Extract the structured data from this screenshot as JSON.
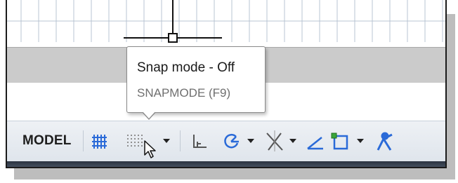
{
  "tooltip": {
    "title": "Snap mode - Off",
    "command": "SNAPMODE (F9)"
  },
  "status_bar": {
    "model_label": "MODEL",
    "icons": [
      "grid-icon",
      "snap-mode-icon",
      "snap-dropdown-icon",
      "ortho-icon",
      "polar-tracking-icon",
      "polar-dropdown-icon",
      "isodraft-icon",
      "isodraft-dropdown-icon",
      "object-snap-tracking-icon",
      "object-snap-icon",
      "object-snap-dropdown-icon",
      "annotation-scale-icon"
    ]
  },
  "colors": {
    "accent_blue": "#2a6ad8",
    "osnap_green": "#3aa63a",
    "tooltip_border": "#8a8a8a",
    "status_bar_bg": "#e6eaf0"
  }
}
